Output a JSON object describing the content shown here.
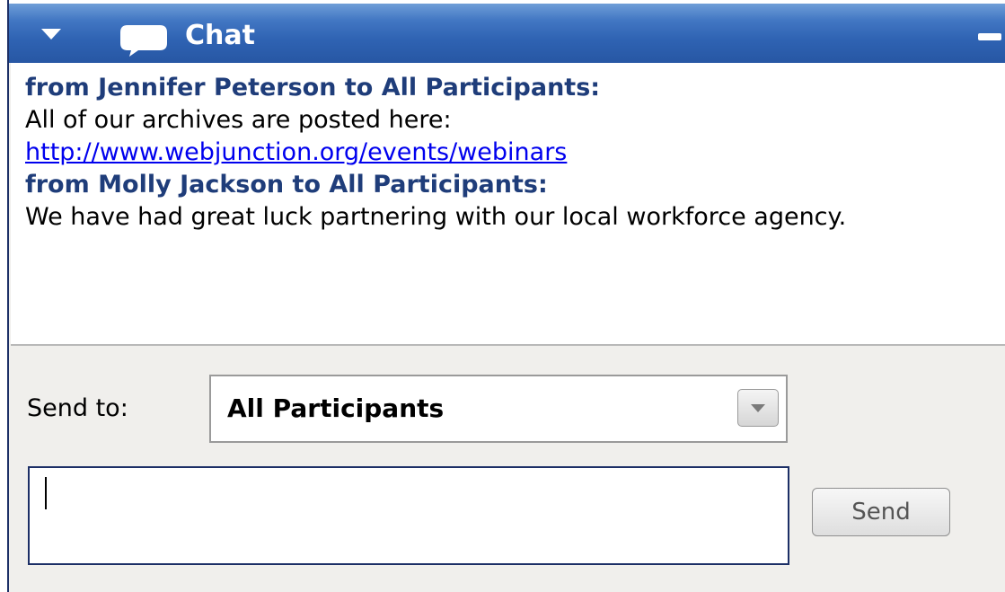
{
  "panel": {
    "title": "Chat",
    "icons": {
      "collapse": "triangle-down-icon",
      "chat": "speech-bubble-icon",
      "minimize": "minimize-icon"
    }
  },
  "messages": [
    {
      "header": "from Jennifer Peterson to All Participants:",
      "text": "All of our archives are posted here:",
      "link": "http://www.webjunction.org/events/webinars"
    },
    {
      "header": "from Molly Jackson to All Participants:",
      "text": "We have had great luck partnering with our local workforce agency.",
      "link": ""
    }
  ],
  "compose": {
    "send_to_label": "Send to:",
    "send_to_value": "All Participants",
    "input_value": "",
    "send_label": "Send"
  },
  "colors": {
    "titlebar": "#2f63b3",
    "sender_header": "#1f3d7a",
    "link": "#0000ee",
    "input_border": "#1c2f66"
  }
}
